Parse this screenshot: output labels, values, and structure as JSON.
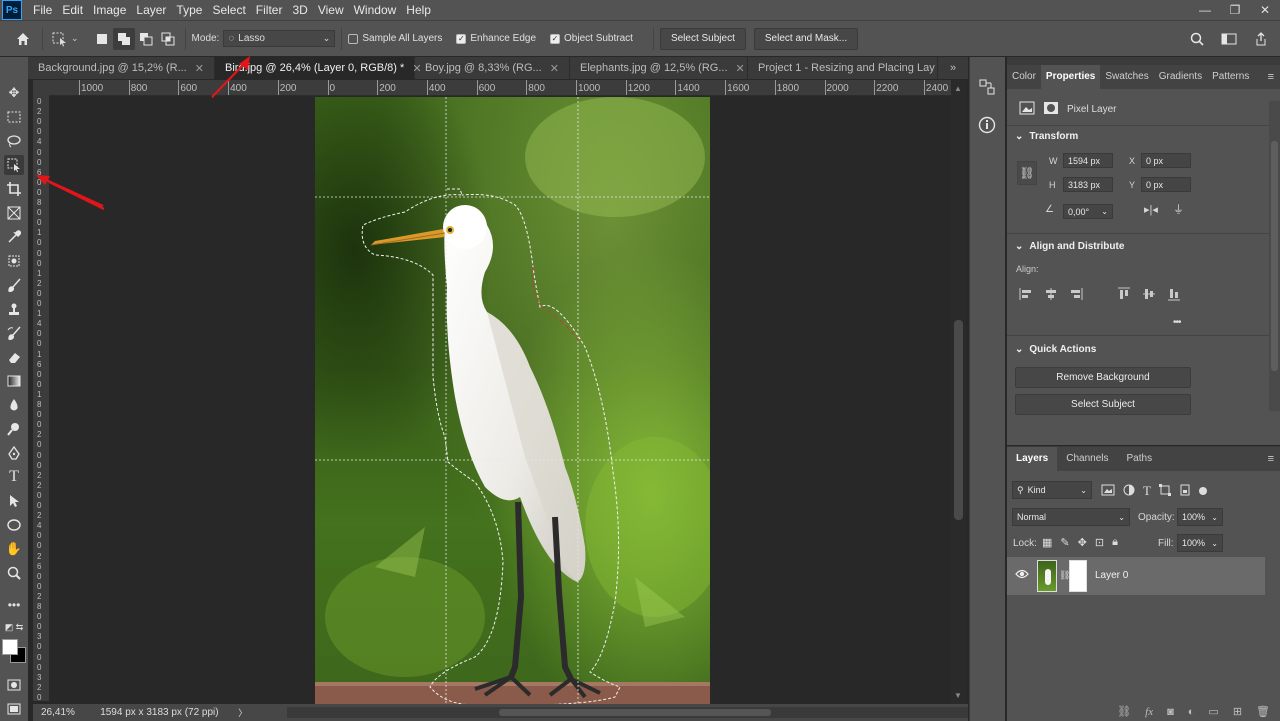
{
  "app": {
    "logo": "Ps"
  },
  "menu": [
    "File",
    "Edit",
    "Image",
    "Layer",
    "Type",
    "Select",
    "Filter",
    "3D",
    "View",
    "Window",
    "Help"
  ],
  "window_controls": {
    "minimize": "—",
    "restore": "❐",
    "close": "✕"
  },
  "options_bar": {
    "mode_label": "Mode:",
    "mode_value": "Lasso",
    "sample_all_layers": "Sample All Layers",
    "enhance_edge": "Enhance Edge",
    "object_subtract": "Object Subtract",
    "select_subject_btn": "Select Subject",
    "select_and_mask_btn": "Select and Mask..."
  },
  "tabs": [
    {
      "label": "Background.jpg @ 15,2% (R...",
      "active": false
    },
    {
      "label": "Bird.jpg @ 26,4% (Layer 0, RGB/8) *",
      "active": true
    },
    {
      "label": "Boy.jpg @ 8,33% (RG...",
      "active": false
    },
    {
      "label": "Elephants.jpg @ 12,5% (RG...",
      "active": false
    },
    {
      "label": "Project 1 - Resizing and Placing Lay",
      "active": false
    }
  ],
  "tab_overflow": "»",
  "ruler_top": [
    "1000",
    "800",
    "600",
    "400",
    "200",
    "0",
    "200",
    "400",
    "600",
    "800",
    "1000",
    "1200",
    "1400",
    "1600",
    "1800",
    "2000",
    "2200",
    "2400"
  ],
  "ruler_left": [
    "0",
    "2",
    "0",
    "0",
    "4",
    "0",
    "0",
    "6",
    "0",
    "0",
    "8",
    "0",
    "0",
    "1",
    "0",
    "0",
    "0",
    "1",
    "2",
    "0",
    "0",
    "1",
    "4",
    "0",
    "0",
    "1",
    "6",
    "0",
    "0",
    "1",
    "8",
    "0",
    "0",
    "2",
    "0",
    "0",
    "0",
    "2",
    "2",
    "0",
    "0",
    "2",
    "4",
    "0",
    "0",
    "2",
    "6",
    "0",
    "0",
    "2",
    "8",
    "0",
    "0",
    "3",
    "0",
    "0",
    "0",
    "3",
    "2",
    "0"
  ],
  "props_tabs": [
    "Color",
    "Properties",
    "Swatches",
    "Gradients",
    "Patterns"
  ],
  "properties": {
    "layer_type": "Pixel Layer",
    "transform_title": "Transform",
    "w_label": "W",
    "w_value": "1594 px",
    "h_label": "H",
    "h_value": "3183 px",
    "x_label": "X",
    "x_value": "0 px",
    "y_label": "Y",
    "y_value": "0 px",
    "angle_value": "0,00°",
    "align_title": "Align and Distribute",
    "align_label": "Align:",
    "more": "•••",
    "quick_actions_title": "Quick Actions",
    "remove_bg_btn": "Remove Background",
    "select_subject_btn": "Select Subject"
  },
  "layers_panel": {
    "tabs": [
      "Layers",
      "Channels",
      "Paths"
    ],
    "kind_label": "Kind",
    "blend_mode": "Normal",
    "opacity_label": "Opacity:",
    "opacity_value": "100%",
    "lock_label": "Lock:",
    "fill_label": "Fill:",
    "fill_value": "100%",
    "layers": [
      {
        "name": "Layer 0",
        "visible": true
      }
    ]
  },
  "status": {
    "zoom": "26,41%",
    "doc_info": "1594 px x 3183 px (72 ppi)"
  },
  "colors": {
    "accent_red": "#e0161a",
    "panel_bg": "#535353",
    "canvas_bg": "#282828"
  }
}
